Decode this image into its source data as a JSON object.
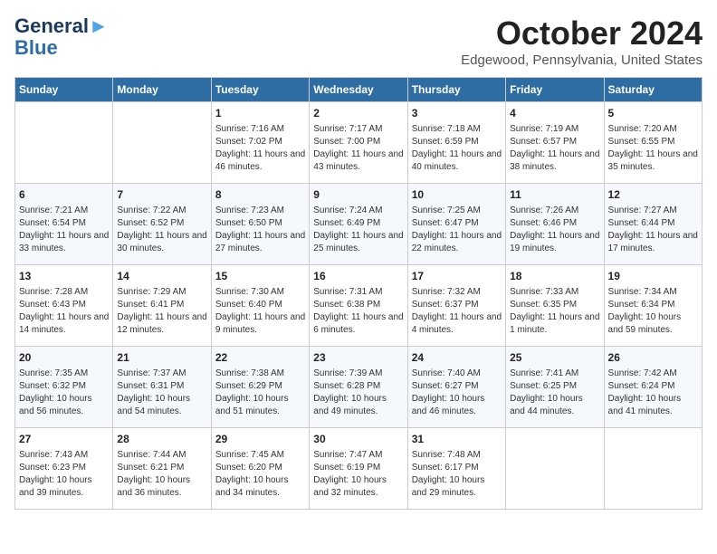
{
  "header": {
    "logo_line1": "General",
    "logo_line2": "Blue",
    "month_title": "October 2024",
    "subtitle": "Edgewood, Pennsylvania, United States"
  },
  "weekdays": [
    "Sunday",
    "Monday",
    "Tuesday",
    "Wednesday",
    "Thursday",
    "Friday",
    "Saturday"
  ],
  "weeks": [
    [
      {
        "day": "",
        "info": ""
      },
      {
        "day": "",
        "info": ""
      },
      {
        "day": "1",
        "info": "Sunrise: 7:16 AM\nSunset: 7:02 PM\nDaylight: 11 hours and 46 minutes."
      },
      {
        "day": "2",
        "info": "Sunrise: 7:17 AM\nSunset: 7:00 PM\nDaylight: 11 hours and 43 minutes."
      },
      {
        "day": "3",
        "info": "Sunrise: 7:18 AM\nSunset: 6:59 PM\nDaylight: 11 hours and 40 minutes."
      },
      {
        "day": "4",
        "info": "Sunrise: 7:19 AM\nSunset: 6:57 PM\nDaylight: 11 hours and 38 minutes."
      },
      {
        "day": "5",
        "info": "Sunrise: 7:20 AM\nSunset: 6:55 PM\nDaylight: 11 hours and 35 minutes."
      }
    ],
    [
      {
        "day": "6",
        "info": "Sunrise: 7:21 AM\nSunset: 6:54 PM\nDaylight: 11 hours and 33 minutes."
      },
      {
        "day": "7",
        "info": "Sunrise: 7:22 AM\nSunset: 6:52 PM\nDaylight: 11 hours and 30 minutes."
      },
      {
        "day": "8",
        "info": "Sunrise: 7:23 AM\nSunset: 6:50 PM\nDaylight: 11 hours and 27 minutes."
      },
      {
        "day": "9",
        "info": "Sunrise: 7:24 AM\nSunset: 6:49 PM\nDaylight: 11 hours and 25 minutes."
      },
      {
        "day": "10",
        "info": "Sunrise: 7:25 AM\nSunset: 6:47 PM\nDaylight: 11 hours and 22 minutes."
      },
      {
        "day": "11",
        "info": "Sunrise: 7:26 AM\nSunset: 6:46 PM\nDaylight: 11 hours and 19 minutes."
      },
      {
        "day": "12",
        "info": "Sunrise: 7:27 AM\nSunset: 6:44 PM\nDaylight: 11 hours and 17 minutes."
      }
    ],
    [
      {
        "day": "13",
        "info": "Sunrise: 7:28 AM\nSunset: 6:43 PM\nDaylight: 11 hours and 14 minutes."
      },
      {
        "day": "14",
        "info": "Sunrise: 7:29 AM\nSunset: 6:41 PM\nDaylight: 11 hours and 12 minutes."
      },
      {
        "day": "15",
        "info": "Sunrise: 7:30 AM\nSunset: 6:40 PM\nDaylight: 11 hours and 9 minutes."
      },
      {
        "day": "16",
        "info": "Sunrise: 7:31 AM\nSunset: 6:38 PM\nDaylight: 11 hours and 6 minutes."
      },
      {
        "day": "17",
        "info": "Sunrise: 7:32 AM\nSunset: 6:37 PM\nDaylight: 11 hours and 4 minutes."
      },
      {
        "day": "18",
        "info": "Sunrise: 7:33 AM\nSunset: 6:35 PM\nDaylight: 11 hours and 1 minute."
      },
      {
        "day": "19",
        "info": "Sunrise: 7:34 AM\nSunset: 6:34 PM\nDaylight: 10 hours and 59 minutes."
      }
    ],
    [
      {
        "day": "20",
        "info": "Sunrise: 7:35 AM\nSunset: 6:32 PM\nDaylight: 10 hours and 56 minutes."
      },
      {
        "day": "21",
        "info": "Sunrise: 7:37 AM\nSunset: 6:31 PM\nDaylight: 10 hours and 54 minutes."
      },
      {
        "day": "22",
        "info": "Sunrise: 7:38 AM\nSunset: 6:29 PM\nDaylight: 10 hours and 51 minutes."
      },
      {
        "day": "23",
        "info": "Sunrise: 7:39 AM\nSunset: 6:28 PM\nDaylight: 10 hours and 49 minutes."
      },
      {
        "day": "24",
        "info": "Sunrise: 7:40 AM\nSunset: 6:27 PM\nDaylight: 10 hours and 46 minutes."
      },
      {
        "day": "25",
        "info": "Sunrise: 7:41 AM\nSunset: 6:25 PM\nDaylight: 10 hours and 44 minutes."
      },
      {
        "day": "26",
        "info": "Sunrise: 7:42 AM\nSunset: 6:24 PM\nDaylight: 10 hours and 41 minutes."
      }
    ],
    [
      {
        "day": "27",
        "info": "Sunrise: 7:43 AM\nSunset: 6:23 PM\nDaylight: 10 hours and 39 minutes."
      },
      {
        "day": "28",
        "info": "Sunrise: 7:44 AM\nSunset: 6:21 PM\nDaylight: 10 hours and 36 minutes."
      },
      {
        "day": "29",
        "info": "Sunrise: 7:45 AM\nSunset: 6:20 PM\nDaylight: 10 hours and 34 minutes."
      },
      {
        "day": "30",
        "info": "Sunrise: 7:47 AM\nSunset: 6:19 PM\nDaylight: 10 hours and 32 minutes."
      },
      {
        "day": "31",
        "info": "Sunrise: 7:48 AM\nSunset: 6:17 PM\nDaylight: 10 hours and 29 minutes."
      },
      {
        "day": "",
        "info": ""
      },
      {
        "day": "",
        "info": ""
      }
    ]
  ]
}
